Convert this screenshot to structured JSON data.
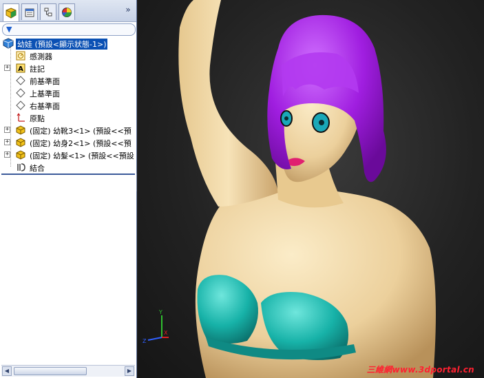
{
  "panel": {
    "tabs": [
      {
        "name": "feature-manager-tab",
        "icon": "feature-tree-icon"
      },
      {
        "name": "property-manager-tab",
        "icon": "property-icon"
      },
      {
        "name": "configuration-manager-tab",
        "icon": "configuration-icon"
      },
      {
        "name": "display-manager-tab",
        "icon": "display-pie-icon"
      }
    ],
    "more_label": "»",
    "filter_label": "▼"
  },
  "tree": {
    "root_label": "幼娃 (預設<顯示狀態-1>)",
    "items": [
      {
        "label": "感測器",
        "icon": "sensor-icon"
      },
      {
        "label": "註記",
        "icon": "annotation-icon"
      },
      {
        "label": "前基準面",
        "icon": "plane-icon"
      },
      {
        "label": "上基準面",
        "icon": "plane-icon"
      },
      {
        "label": "右基準面",
        "icon": "plane-icon"
      },
      {
        "label": "原點",
        "icon": "origin-icon"
      },
      {
        "label": "(固定) 幼靴3<1> (預設<<預",
        "icon": "part-icon"
      },
      {
        "label": "(固定) 幼身2<1> (預設<<預",
        "icon": "part-icon"
      },
      {
        "label": "(固定) 幼髮<1> (預設<<預設",
        "icon": "part-icon"
      },
      {
        "label": "結合",
        "icon": "mates-icon"
      }
    ]
  },
  "viewport": {
    "watermark": "三維網www.3dportal.cn",
    "triad_axes": [
      "Y",
      "Z",
      "X"
    ]
  },
  "colors": {
    "selection": "#0a50b4",
    "skin": "#f3deb0",
    "hair": "#a020e0",
    "swimsuit": "#1fb8b0",
    "background": "#222222",
    "watermark": "#ff2030"
  }
}
